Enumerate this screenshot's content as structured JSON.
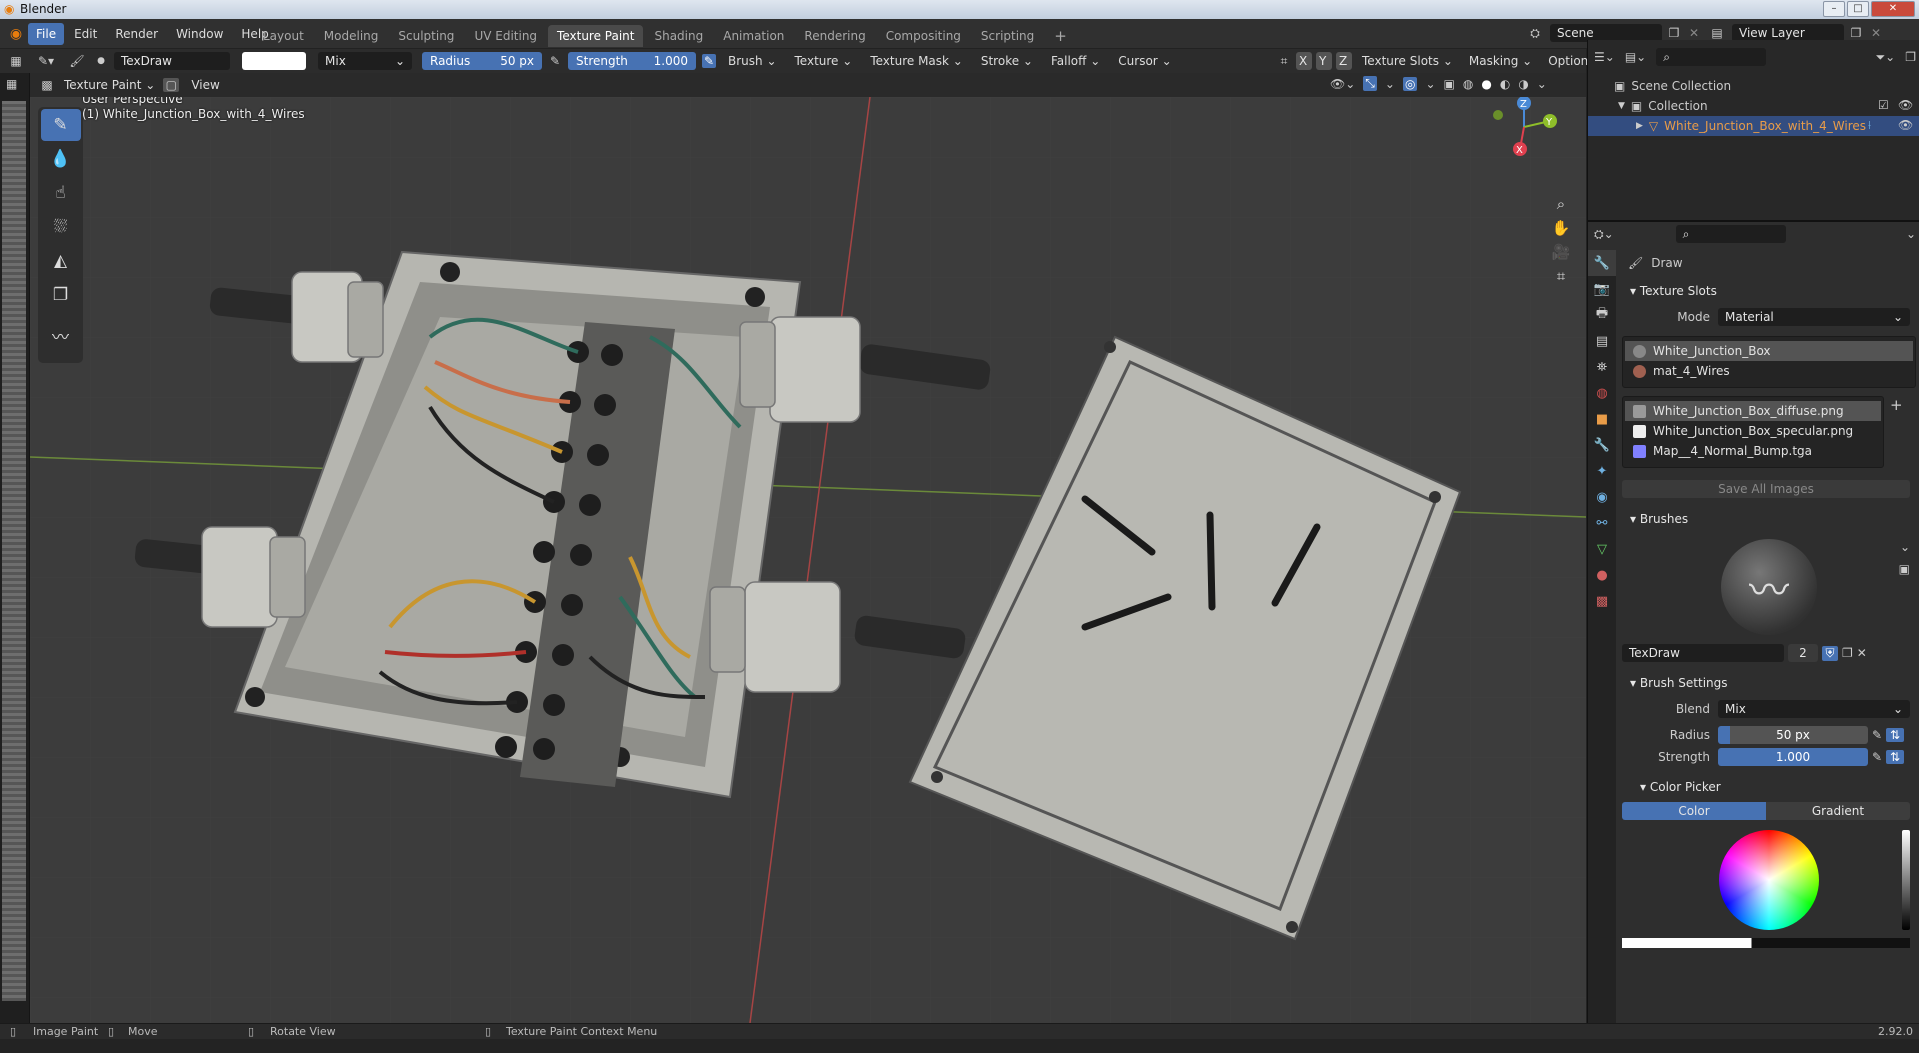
{
  "window": {
    "title": "Blender",
    "minimize": "–",
    "maximize": "□",
    "close": "✕"
  },
  "menubar": {
    "items": [
      "File",
      "Edit",
      "Render",
      "Window",
      "Help"
    ],
    "workspaces": [
      "Layout",
      "Modeling",
      "Sculpting",
      "UV Editing",
      "Texture Paint",
      "Shading",
      "Animation",
      "Rendering",
      "Compositing",
      "Scripting"
    ],
    "add_tab": "+",
    "scene_label": "Scene",
    "view_layer_label": "View Layer"
  },
  "tool_header": {
    "brush_name": "TexDraw",
    "blend_mode": "Mix",
    "radius_label": "Radius",
    "radius_value": "50 px",
    "strength_label": "Strength",
    "strength_value": "1.000",
    "menus": [
      "Brush",
      "Texture",
      "Texture Mask",
      "Stroke",
      "Falloff",
      "Cursor"
    ],
    "axis_x": "X",
    "axis_y": "Y",
    "axis_z": "Z",
    "right_menus": [
      "Texture Slots",
      "Masking",
      "Options"
    ]
  },
  "viewport_header": {
    "mode": "Texture Paint",
    "view_menu": "View"
  },
  "viewport": {
    "perspective_label": "User Perspective",
    "object_label": "(1) White_Junction_Box_with_4_Wires",
    "gizmo": {
      "z": "Z",
      "y": "Y",
      "x": "X"
    }
  },
  "outliner": {
    "root": "Scene Collection",
    "collection": "Collection",
    "object": "White_Junction_Box_with_4_Wires"
  },
  "properties": {
    "brush_header": "Draw",
    "texture_slots": {
      "title": "Texture Slots",
      "mode_label": "Mode",
      "mode_value": "Material",
      "materials": [
        "White_Junction_Box",
        "mat_4_Wires"
      ],
      "images": [
        {
          "name": "White_Junction_Box_diffuse.png",
          "color": "#9a9a9a"
        },
        {
          "name": "White_Junction_Box_specular.png",
          "color": "#eeeeee"
        },
        {
          "name": "Map__4_Normal_Bump.tga",
          "color": "#8080ff"
        }
      ],
      "save_all": "Save All Images"
    },
    "brushes": {
      "title": "Brushes",
      "brush_name": "TexDraw",
      "users": "2"
    },
    "brush_settings": {
      "title": "Brush Settings",
      "blend_label": "Blend",
      "blend_value": "Mix",
      "radius_label": "Radius",
      "radius_value": "50 px",
      "strength_label": "Strength",
      "strength_value": "1.000"
    },
    "color_picker": {
      "title": "Color Picker",
      "tab_color": "Color",
      "tab_gradient": "Gradient"
    }
  },
  "statusbar": {
    "left_action": "Image Paint",
    "move": "Move",
    "rotate": "Rotate View",
    "context": "Texture Paint Context Menu",
    "version": "2.92.0"
  },
  "colors": {
    "accent": "#4772b3",
    "active_object": "#e99c48"
  }
}
